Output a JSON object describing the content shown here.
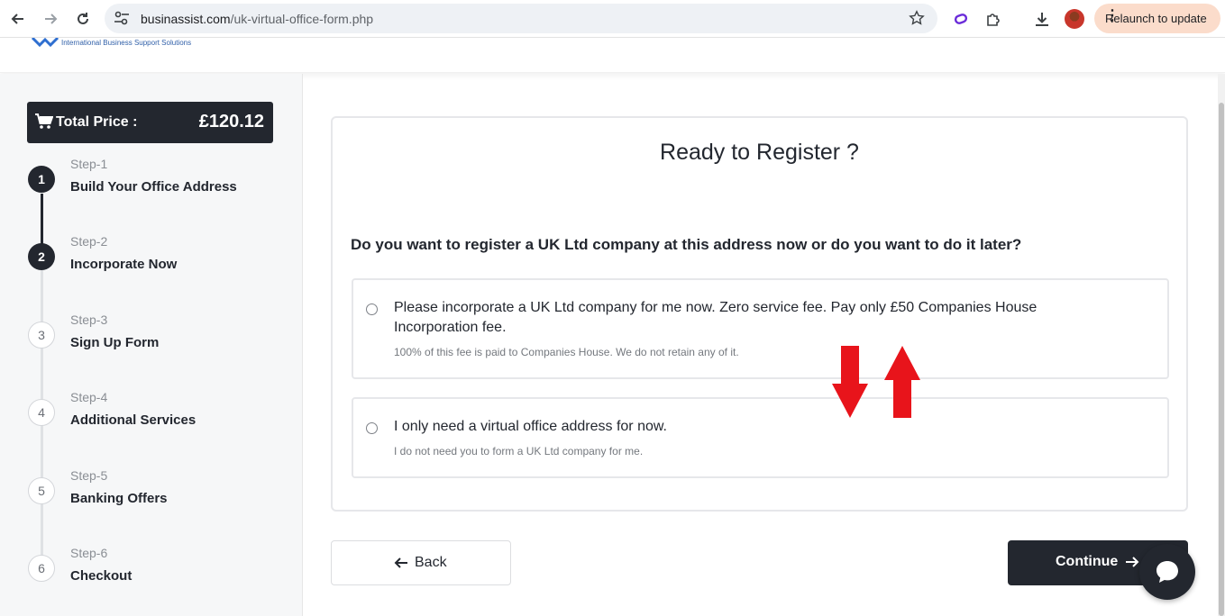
{
  "browser": {
    "url_host": "businassist.com",
    "url_path": "/uk-virtual-office-form.php",
    "relaunch_label": "Relaunch to update"
  },
  "site": {
    "logo_tagline": "International Business Support Solutions"
  },
  "sidebar": {
    "total_label": "Total Price :",
    "total_amount": "£120.12",
    "steps": [
      {
        "num": "1",
        "step": "Step-1",
        "title": "Build Your Office Address",
        "state": "done"
      },
      {
        "num": "2",
        "step": "Step-2",
        "title": "Incorporate Now",
        "state": "current"
      },
      {
        "num": "3",
        "step": "Step-3",
        "title": "Sign Up Form",
        "state": "pending"
      },
      {
        "num": "4",
        "step": "Step-4",
        "title": "Additional Services",
        "state": "pending"
      },
      {
        "num": "5",
        "step": "Step-5",
        "title": "Banking Offers",
        "state": "pending"
      },
      {
        "num": "6",
        "step": "Step-6",
        "title": "Checkout",
        "state": "pending"
      }
    ]
  },
  "main": {
    "title": "Ready to Register ?",
    "question": "Do you want to register a UK Ltd company at this address now or do you want to do it later?",
    "options": [
      {
        "title": "Please incorporate a UK Ltd company for me now. Zero service fee. Pay only £50 Companies House Incorporation fee.",
        "note": "100% of this fee is paid to Companies House. We do not retain any of it.",
        "selected": false
      },
      {
        "title": "I only need a virtual office address for now.",
        "note": "I do not need you to form a UK Ltd company for me.",
        "selected": false
      }
    ],
    "back_label": "Back",
    "continue_label": "Continue"
  },
  "colors": {
    "dark": "#23272f",
    "annotation_arrow": "#e8141b",
    "relaunch_bg": "#fbdccb"
  },
  "icons": [
    "back-arrow-icon",
    "forward-arrow-icon",
    "reload-icon",
    "site-settings-icon",
    "bookmark-star-icon",
    "extension-icon",
    "puzzle-icon",
    "download-icon",
    "kebab-menu-icon",
    "cart-icon",
    "arrow-left-icon",
    "arrow-right-icon",
    "chat-icon"
  ]
}
